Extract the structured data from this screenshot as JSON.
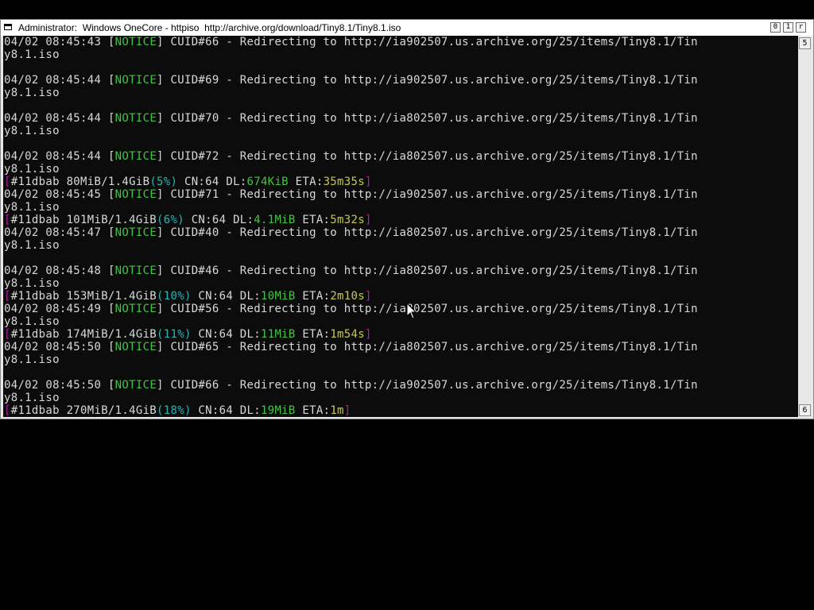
{
  "window": {
    "title": "Administrator:  Windows OneCore - httpiso  http://archive.org/download/Tiny8.1/Tiny8.1.iso",
    "controls": {
      "minimize": "0",
      "maximize": "1",
      "close": "r"
    },
    "scrollbar": {
      "up": "5",
      "down": "6"
    }
  },
  "console": {
    "lines": [
      {
        "t": "notice",
        "time": "04/02 08:45:43 ",
        "tag": "NOTICE",
        "msg": " CUID#66 - Redirecting to http://ia902507.us.archive.org/25/items/Tiny8.1/Tin"
      },
      {
        "t": "plain",
        "text": "y8.1.iso"
      },
      {
        "t": "plain",
        "text": ""
      },
      {
        "t": "notice",
        "time": "04/02 08:45:44 ",
        "tag": "NOTICE",
        "msg": " CUID#69 - Redirecting to http://ia902507.us.archive.org/25/items/Tiny8.1/Tin"
      },
      {
        "t": "plain",
        "text": "y8.1.iso"
      },
      {
        "t": "plain",
        "text": ""
      },
      {
        "t": "notice",
        "time": "04/02 08:45:44 ",
        "tag": "NOTICE",
        "msg": " CUID#70 - Redirecting to http://ia802507.us.archive.org/25/items/Tiny8.1/Tin"
      },
      {
        "t": "plain",
        "text": "y8.1.iso"
      },
      {
        "t": "plain",
        "text": ""
      },
      {
        "t": "notice",
        "time": "04/02 08:45:44 ",
        "tag": "NOTICE",
        "msg": " CUID#72 - Redirecting to http://ia802507.us.archive.org/25/items/Tiny8.1/Tin"
      },
      {
        "t": "plain",
        "text": "y8.1.iso"
      },
      {
        "t": "progress",
        "head": "#11dbab 80MiB/1.4GiB",
        "pct": "(5%)",
        "cn": " CN:64 DL:",
        "dl": "674KiB",
        "etalabel": " ETA:",
        "eta": "35m35s"
      },
      {
        "t": "notice",
        "time": "04/02 08:45:45 ",
        "tag": "NOTICE",
        "msg": " CUID#71 - Redirecting to http://ia902507.us.archive.org/25/items/Tiny8.1/Tin"
      },
      {
        "t": "plain",
        "text": "y8.1.iso"
      },
      {
        "t": "progress",
        "head": "#11dbab 101MiB/1.4GiB",
        "pct": "(6%)",
        "cn": " CN:64 DL:",
        "dl": "4.1MiB",
        "etalabel": " ETA:",
        "eta": "5m32s"
      },
      {
        "t": "notice",
        "time": "04/02 08:45:47 ",
        "tag": "NOTICE",
        "msg": " CUID#40 - Redirecting to http://ia802507.us.archive.org/25/items/Tiny8.1/Tin"
      },
      {
        "t": "plain",
        "text": "y8.1.iso"
      },
      {
        "t": "plain",
        "text": ""
      },
      {
        "t": "notice",
        "time": "04/02 08:45:48 ",
        "tag": "NOTICE",
        "msg": " CUID#46 - Redirecting to http://ia802507.us.archive.org/25/items/Tiny8.1/Tin"
      },
      {
        "t": "plain",
        "text": "y8.1.iso"
      },
      {
        "t": "progress",
        "head": "#11dbab 153MiB/1.4GiB",
        "pct": "(10%)",
        "cn": " CN:64 DL:",
        "dl": "10MiB",
        "etalabel": " ETA:",
        "eta": "2m10s"
      },
      {
        "t": "notice",
        "time": "04/02 08:45:49 ",
        "tag": "NOTICE",
        "msg": " CUID#56 - Redirecting to http://ia802507.us.archive.org/25/items/Tiny8.1/Tin"
      },
      {
        "t": "plain",
        "text": "y8.1.iso"
      },
      {
        "t": "progress",
        "head": "#11dbab 174MiB/1.4GiB",
        "pct": "(11%)",
        "cn": " CN:64 DL:",
        "dl": "11MiB",
        "etalabel": " ETA:",
        "eta": "1m54s"
      },
      {
        "t": "notice",
        "time": "04/02 08:45:50 ",
        "tag": "NOTICE",
        "msg": " CUID#65 - Redirecting to http://ia802507.us.archive.org/25/items/Tiny8.1/Tin"
      },
      {
        "t": "plain",
        "text": "y8.1.iso"
      },
      {
        "t": "plain",
        "text": ""
      },
      {
        "t": "notice",
        "time": "04/02 08:45:50 ",
        "tag": "NOTICE",
        "msg": " CUID#66 - Redirecting to http://ia902507.us.archive.org/25/items/Tiny8.1/Tin"
      },
      {
        "t": "plain",
        "text": "y8.1.iso"
      },
      {
        "t": "progress",
        "head": "#11dbab 270MiB/1.4GiB",
        "pct": "(18%)",
        "cn": " CN:64 DL:",
        "dl": "19MiB",
        "etalabel": " ETA:",
        "eta": "1m"
      }
    ]
  },
  "colors": {
    "background": "#0c0c0c",
    "text": "#d8d8d8",
    "notice": "#3fc53f",
    "bracket": "#b0209a",
    "percent": "#27b5b5",
    "download_rate": "#3fc53f",
    "eta": "#c9c94a"
  },
  "icons": {
    "window": "console-window-icon",
    "pointer": "mouse-pointer-icon"
  }
}
